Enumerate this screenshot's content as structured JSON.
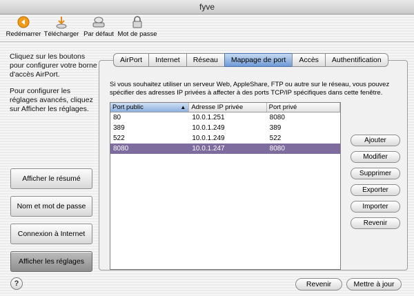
{
  "window": {
    "title": "fyve"
  },
  "toolbar": {
    "items": [
      {
        "label": "Redémarrer",
        "icon": "restart-icon"
      },
      {
        "label": "Télécharger",
        "icon": "download-icon"
      },
      {
        "label": "Par défaut",
        "icon": "default-icon"
      },
      {
        "label": "Mot de passe",
        "icon": "lock-icon"
      }
    ]
  },
  "sidebar": {
    "text1": "Cliquez sur les boutons pour configurer votre borne d'accès AirPort.",
    "text2": "Pour configurer les réglages avancés, cliquez sur Afficher les réglages.",
    "buttons": [
      {
        "label": "Afficher le résumé"
      },
      {
        "label": "Nom et mot de passe"
      },
      {
        "label": "Connexion à Internet"
      },
      {
        "label": "Afficher les réglages"
      }
    ]
  },
  "tabs": [
    {
      "label": "AirPort"
    },
    {
      "label": "Internet"
    },
    {
      "label": "Réseau"
    },
    {
      "label": "Mappage de port"
    },
    {
      "label": "Accès"
    },
    {
      "label": "Authentification"
    }
  ],
  "main": {
    "description": "Si vous souhaitez utiliser un serveur Web, AppleShare, FTP ou autre sur le réseau, vous pouvez spécifier des adresses IP privées à affecter à des ports TCP/IP spécifiques dans cette fenêtre.",
    "table": {
      "headers": [
        "Port public",
        "Adresse IP privée",
        "Port privé"
      ],
      "rows": [
        [
          "80",
          "10.0.1.251",
          "8080"
        ],
        [
          "389",
          "10.0.1.249",
          "389"
        ],
        [
          "522",
          "10.0.1.249",
          "522"
        ],
        [
          "8080",
          "10.0.1.247",
          "8080"
        ]
      ]
    },
    "side_buttons": [
      {
        "label": "Ajouter"
      },
      {
        "label": "Modifier"
      },
      {
        "label": "Supprimer"
      },
      {
        "label": "Exporter"
      },
      {
        "label": "Importer"
      },
      {
        "label": "Revenir"
      }
    ]
  },
  "footer": {
    "help": "?",
    "revert_label": "Revenir",
    "update_label": "Mettre à jour"
  },
  "colors": {
    "selected_row": "#7e6c9e",
    "active_tab": "#6f9bd6",
    "restart_icon": "#f29a1a"
  }
}
